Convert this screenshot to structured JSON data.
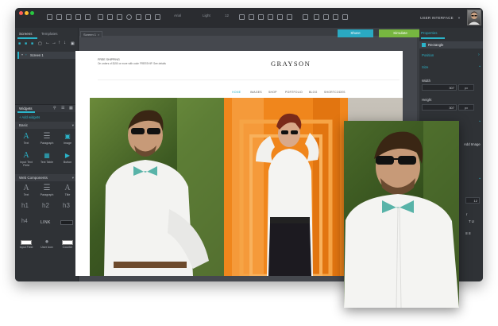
{
  "toolbar": {
    "font_value": "Arial",
    "weight_value": "Light",
    "size_value": "12",
    "ui_label": "USER INTERFACE"
  },
  "left_panel": {
    "tabs": [
      "Screens",
      "Templates"
    ],
    "tree_item": "Screen 1",
    "widgets_tab": "Widgets",
    "add_widgets": "+ Add widgets",
    "basic_header": "Basic",
    "basic_widgets": [
      "Text",
      "Paragraph",
      "Image",
      "Input Text Field",
      "Text Table",
      "Button"
    ],
    "web_header": "Web Components",
    "web_widgets_row1": [
      "Text",
      "Paragraph",
      "Title"
    ],
    "headings": [
      "h1",
      "h2",
      "h3",
      "h4"
    ],
    "link_label": "LINK",
    "web_widgets_row3": [
      "Input Field",
      "User Icon",
      "Counter"
    ]
  },
  "canvas": {
    "doc_tab": "Screen 1",
    "share_label": "Share",
    "simulate_label": "Simulate",
    "site": {
      "promo_line1": "FREE SHIPPING",
      "promo_line2": "On orders of $150 or more with code FREESHIP. See details",
      "brand": "GRAYSON",
      "nav": [
        "HOME",
        "IMAGES",
        "SHOP",
        "PORTFOLIO",
        "BLOG",
        "SHORTCODES"
      ]
    }
  },
  "right_panel": {
    "tab": "Properties",
    "selected": "Rectangle",
    "position_label": "Position",
    "size_label": "Size",
    "width_label": "Width",
    "width_value": "307",
    "width_unit": "px",
    "height_label": "Height",
    "height_value": "307",
    "height_unit": "px",
    "add_image": "Add Image",
    "field_value": "12"
  },
  "colors": {
    "accent": "#2bb4c9",
    "simulate": "#77b640",
    "orange": "#f0861c"
  }
}
